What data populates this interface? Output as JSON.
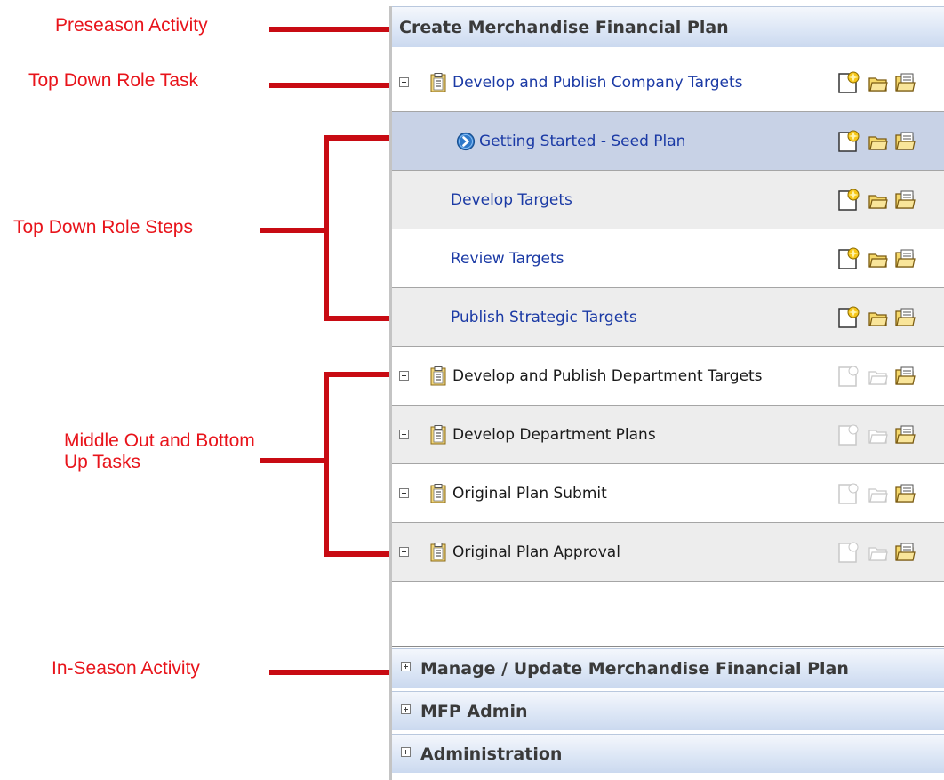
{
  "annotations": {
    "preseason": "Preseason Activity",
    "top_down_task": "Top Down Role Task",
    "top_down_steps": "Top Down Role Steps",
    "middle_out": "Middle Out and Bottom Up Tasks",
    "in_season": "In-Season Activity"
  },
  "panel": {
    "header": "Create Merchandise Financial Plan",
    "rows": [
      {
        "label": "Develop and Publish Company Targets",
        "kind": "task",
        "expanded": true,
        "actions_enabled": true
      },
      {
        "label": "Getting Started - Seed Plan",
        "kind": "step",
        "selected": true,
        "actions_enabled": true
      },
      {
        "label": "Develop Targets",
        "kind": "step",
        "actions_enabled": true
      },
      {
        "label": "Review Targets",
        "kind": "step",
        "actions_enabled": true
      },
      {
        "label": "Publish Strategic Targets",
        "kind": "step",
        "actions_enabled": true
      },
      {
        "label": "Develop and Publish Department Targets",
        "kind": "task",
        "expanded": false,
        "actions_enabled": false
      },
      {
        "label": "Develop Department Plans",
        "kind": "task",
        "expanded": false,
        "actions_enabled": false
      },
      {
        "label": "Original Plan Submit",
        "kind": "task",
        "expanded": false,
        "actions_enabled": false
      },
      {
        "label": "Original Plan Approval",
        "kind": "task",
        "expanded": false,
        "actions_enabled": false
      }
    ],
    "collapsed_sections": [
      {
        "label": "Manage / Update Merchandise Financial Plan"
      },
      {
        "label": "MFP Admin"
      },
      {
        "label": "Administration"
      }
    ]
  },
  "icons": {
    "task": "task-list-icon",
    "step": "step-arrow-icon",
    "actions": [
      "new-workbook-icon",
      "open-workbook-icon",
      "open-all-workbooks-icon"
    ]
  },
  "colors": {
    "annotation_red": "#e8141b",
    "link_blue": "#1b3aa5",
    "selected_row": "#c8d2e6",
    "gray_row": "#ededed"
  }
}
